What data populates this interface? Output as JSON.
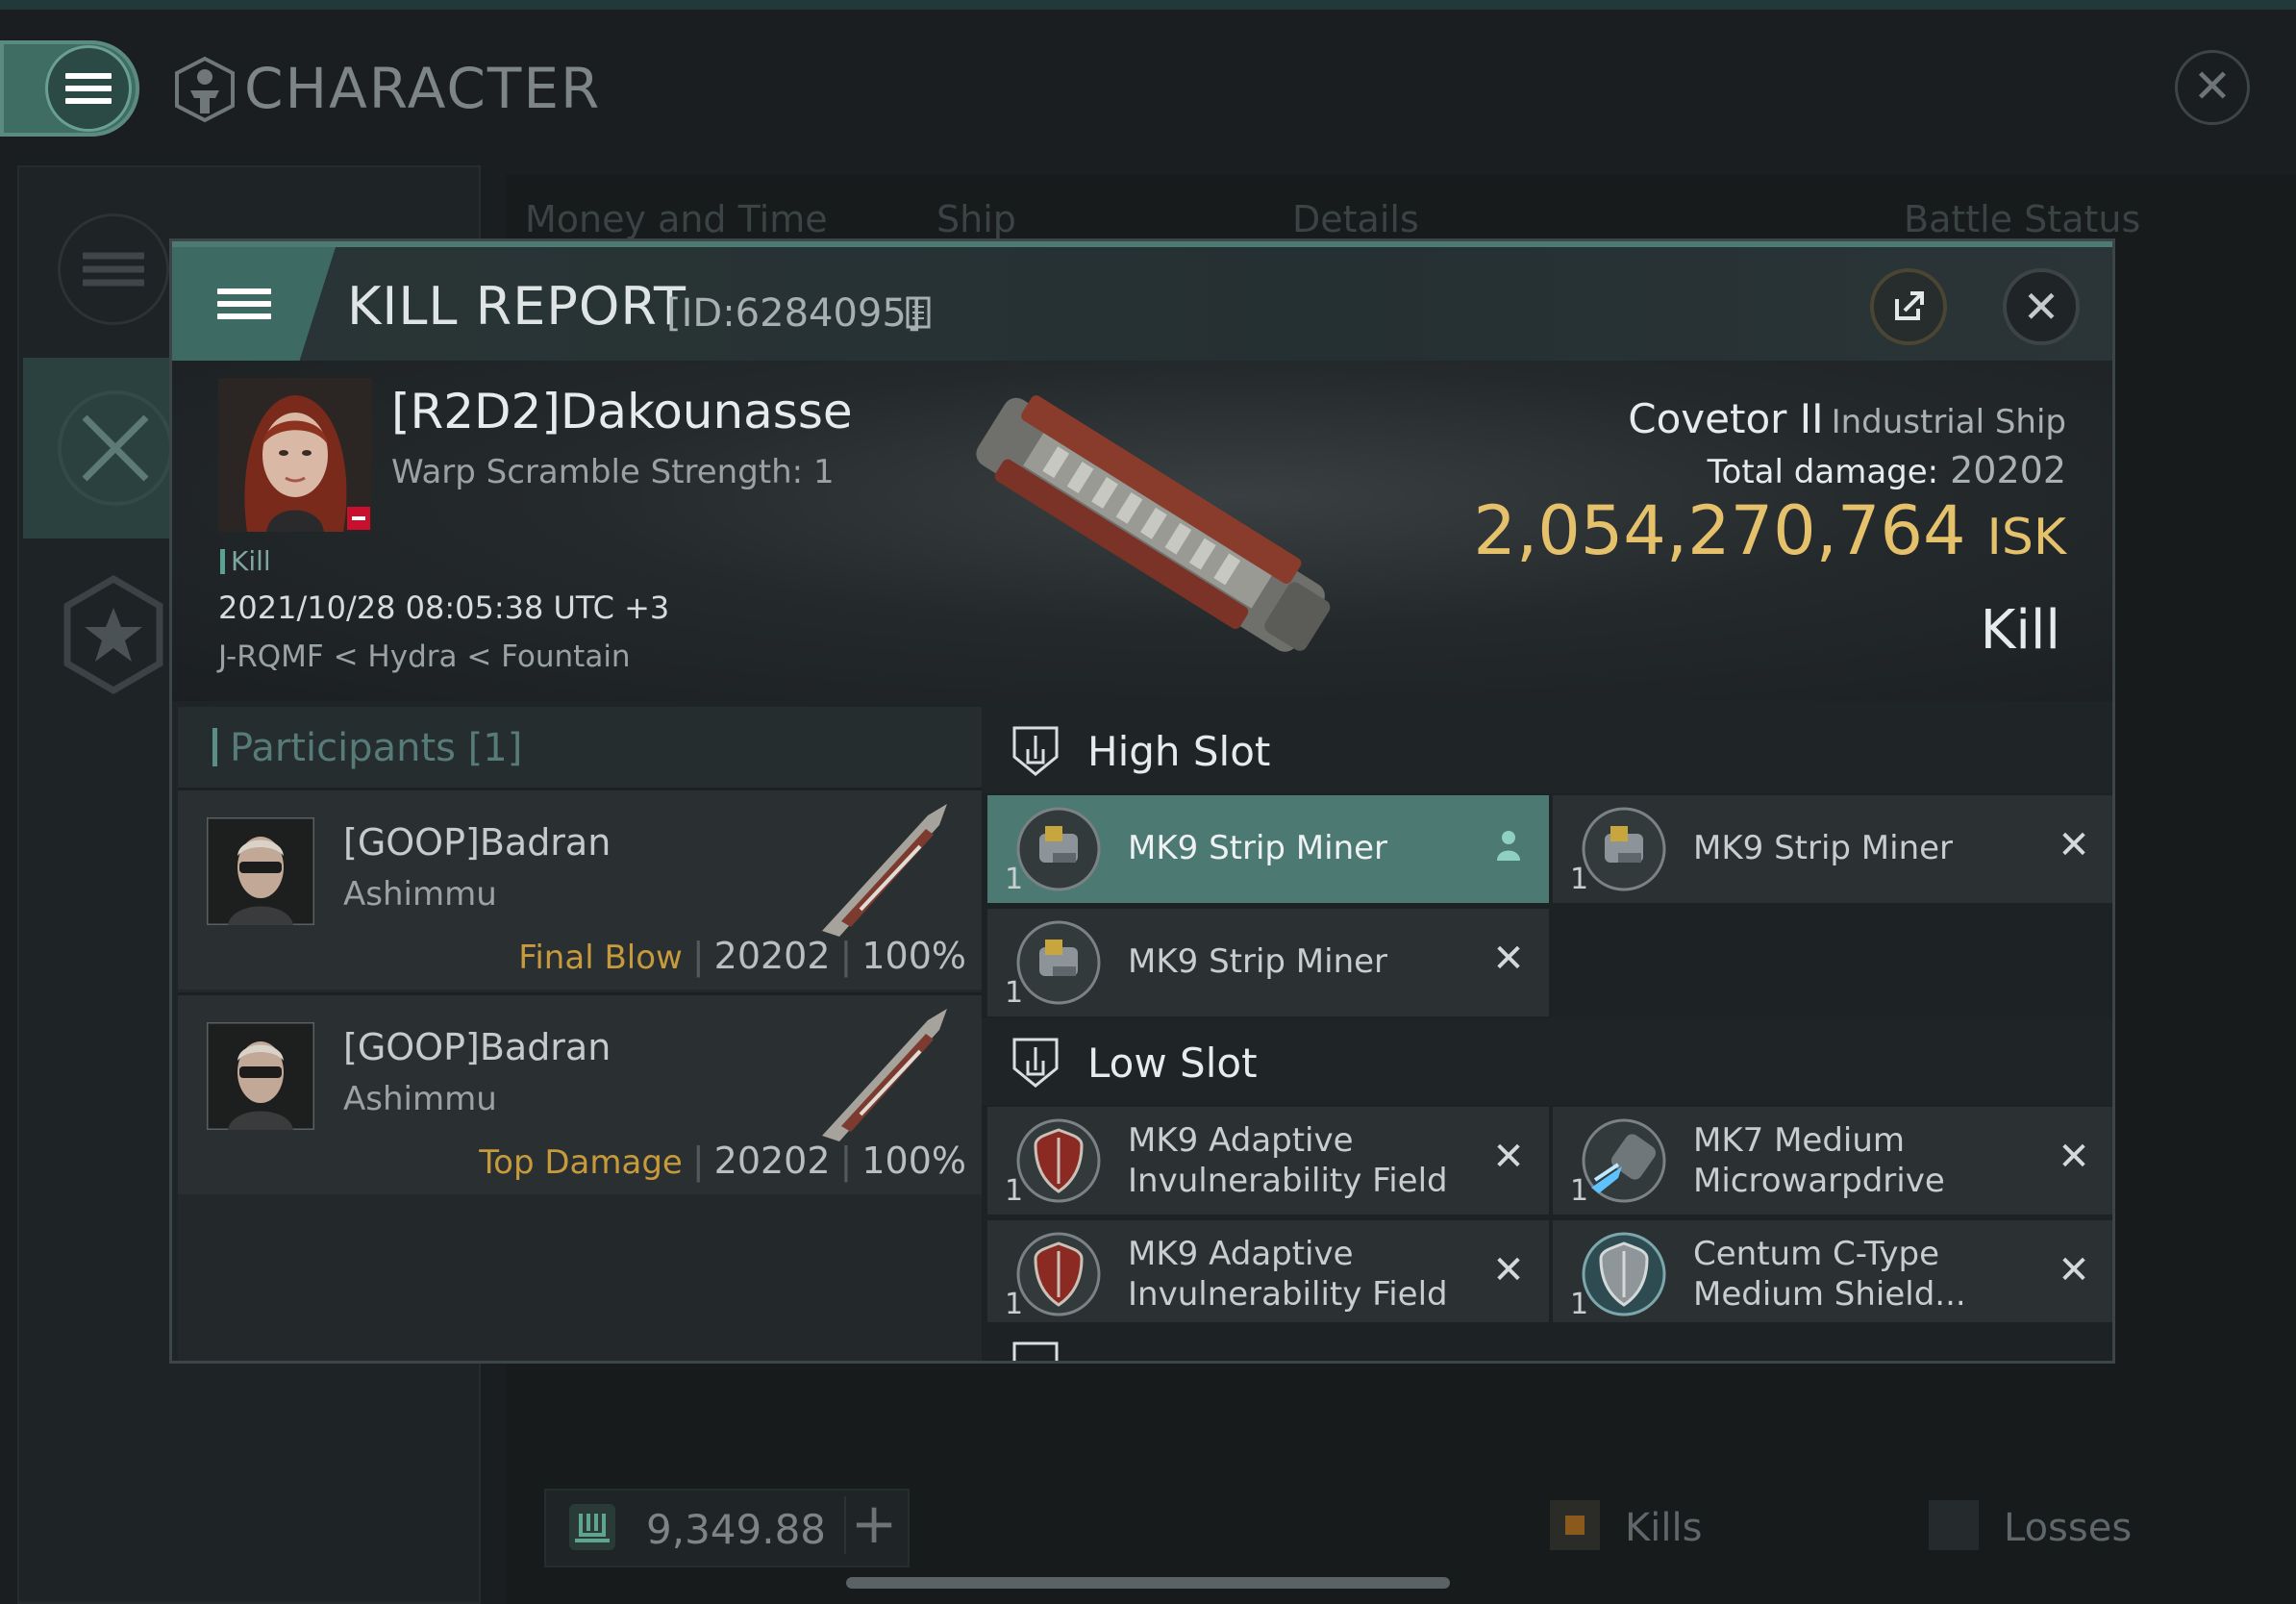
{
  "app": {
    "title": "CHARACTER",
    "tabs": [
      "Money and Time",
      "Ship",
      "Details",
      "Battle Status"
    ],
    "wallet_value": "9,349.88",
    "legend_kills": "Kills",
    "legend_losses": "Losses",
    "colors": {
      "accent": "#4c7a72",
      "isk": "#e6c16c",
      "final_blow": "#c79a3b"
    }
  },
  "kill_report": {
    "title": "KILL REPORT",
    "id_label": "[ID:6284095]",
    "victim": {
      "name": "[R2D2]Dakounasse",
      "warp_scramble": "Warp Scramble Strength: 1",
      "kill_tag": "Kill",
      "datetime": "2021/10/28 08:05:38 UTC +3",
      "location": "J-RQMF < Hydra < Fountain"
    },
    "ship": {
      "name": "Covetor II",
      "class": "Industrial Ship",
      "total_damage_label": "Total damage:",
      "total_damage": "20202",
      "isk_value": "2,054,270,764",
      "isk_unit": "ISK",
      "result": "Kill"
    },
    "participants": {
      "title": "Participants [1]",
      "rows": [
        {
          "name": "[GOOP]Badran",
          "ship": "Ashimmu",
          "role": "Final Blow",
          "damage": "20202",
          "percent": "100%"
        },
        {
          "name": "[GOOP]Badran",
          "ship": "Ashimmu",
          "role": "Top Damage",
          "damage": "20202",
          "percent": "100%"
        }
      ]
    },
    "fitting": {
      "high_slot_title": "High Slot",
      "low_slot_title": "Low Slot",
      "high_modules": [
        {
          "name_line1": "MK9 Strip Miner",
          "name_line2": "",
          "qty": "1",
          "icon": "strip-miner-icon",
          "status": "person-icon"
        },
        {
          "name_line1": "MK9 Strip Miner",
          "name_line2": "",
          "qty": "1",
          "icon": "strip-miner-icon",
          "status": "destroyed-x"
        },
        {
          "name_line1": "MK9 Strip Miner",
          "name_line2": "",
          "qty": "1",
          "icon": "strip-miner-icon",
          "status": "destroyed-x"
        }
      ],
      "low_modules": [
        {
          "name_line1": "MK9 Adaptive",
          "name_line2": "Invulnerability Field",
          "qty": "1",
          "icon": "invuln-field-icon",
          "status": "destroyed-x"
        },
        {
          "name_line1": "MK7 Medium",
          "name_line2": "Microwarpdrive",
          "qty": "1",
          "icon": "microwarpdrive-icon",
          "status": "destroyed-x"
        },
        {
          "name_line1": "MK9 Adaptive",
          "name_line2": "Invulnerability Field",
          "qty": "1",
          "icon": "invuln-field-icon",
          "status": "destroyed-x"
        },
        {
          "name_line1": "Centum C-Type",
          "name_line2": "Medium Shield...",
          "qty": "1",
          "icon": "shield-extender-icon",
          "status": "destroyed-x"
        }
      ]
    }
  }
}
